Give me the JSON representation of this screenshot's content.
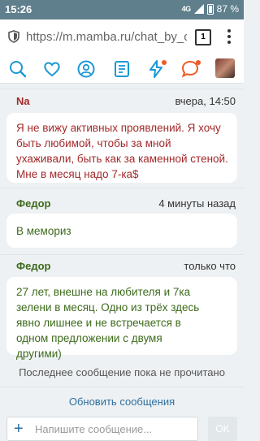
{
  "status": {
    "time": "15:26",
    "network": "4G",
    "battery": "87 %"
  },
  "browser": {
    "url": "https://m.mamba.ru/chat_by_con",
    "tabs_count": "1"
  },
  "nav": {
    "icons": [
      "search-icon",
      "heart-icon",
      "face-icon",
      "news-icon",
      "bolt-icon",
      "chat-bubble-icon"
    ],
    "accent": "#1a98d5",
    "notification_color": "#f05a24"
  },
  "messages": [
    {
      "author": "Na",
      "time": "вчера, 14:50",
      "text": "Я не вижу активных проявлений. Я хочу быть любимой, чтобы за мной ухаживали, быть как за каменной стеной. Мне в месяц надо 7-ка$",
      "color": "#a3292a"
    },
    {
      "author": "Федор",
      "time": "4 минуты назад",
      "text": "В мемориз",
      "color": "#3d6b1c"
    },
    {
      "author": "Федор",
      "time": "только что",
      "text": "27 лет, внешне на любителя и 7ка зелени в месяц. Одно из трёх здесь явно лишнее и не встречается в одном предложении с двумя другими)",
      "color": "#3d6b1c"
    }
  ],
  "footer": {
    "unread_note": "Последнее сообщение пока не прочитано",
    "refresh": "Обновить сообщения"
  },
  "composer": {
    "placeholder": "Напишите сообщение...",
    "ok": "OK"
  }
}
